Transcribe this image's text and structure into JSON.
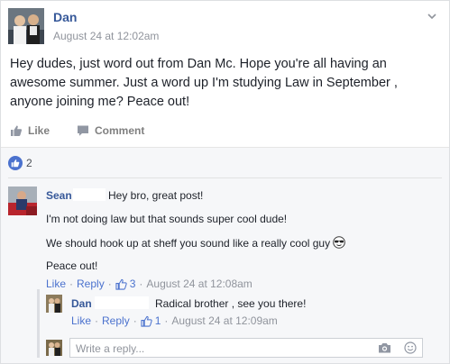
{
  "post": {
    "author": "Dan",
    "timestamp": "August 24 at 12:02am",
    "text": "Hey dudes, just word out from Dan Mc. Hope you're all having an awesome summer. Just a word up I'm studying Law in September , anyone joining me? Peace out!",
    "like_label": "Like",
    "comment_label": "Comment",
    "like_count": "2"
  },
  "comment": {
    "name": "Sean",
    "text1": "Hey bro, great post!",
    "text2": "I'm not doing law but that sounds super cool dude!",
    "text3": "We should hook up at sheff you sound like a really cool guy",
    "text4": "Peace out!",
    "like_label": "Like",
    "reply_label": "Reply",
    "likes": "3",
    "timestamp": "August 24 at 12:08am"
  },
  "reply": {
    "name": "Dan",
    "text": "Radical brother , see you there!",
    "like_label": "Like",
    "reply_label": "Reply",
    "likes": "1",
    "timestamp": "August 24 at 12:09am"
  },
  "write_reply": {
    "placeholder": "Write a reply..."
  },
  "icons": {
    "menu": "chevron-down-icon",
    "like": "thumbs-up-icon",
    "comment": "speech-bubble-icon",
    "camera": "camera-icon",
    "emoji": "smiley-icon"
  },
  "colors": {
    "link": "#365899",
    "accent": "#4b72ce",
    "muted": "#90949c",
    "background_gray": "#f6f7f9"
  }
}
